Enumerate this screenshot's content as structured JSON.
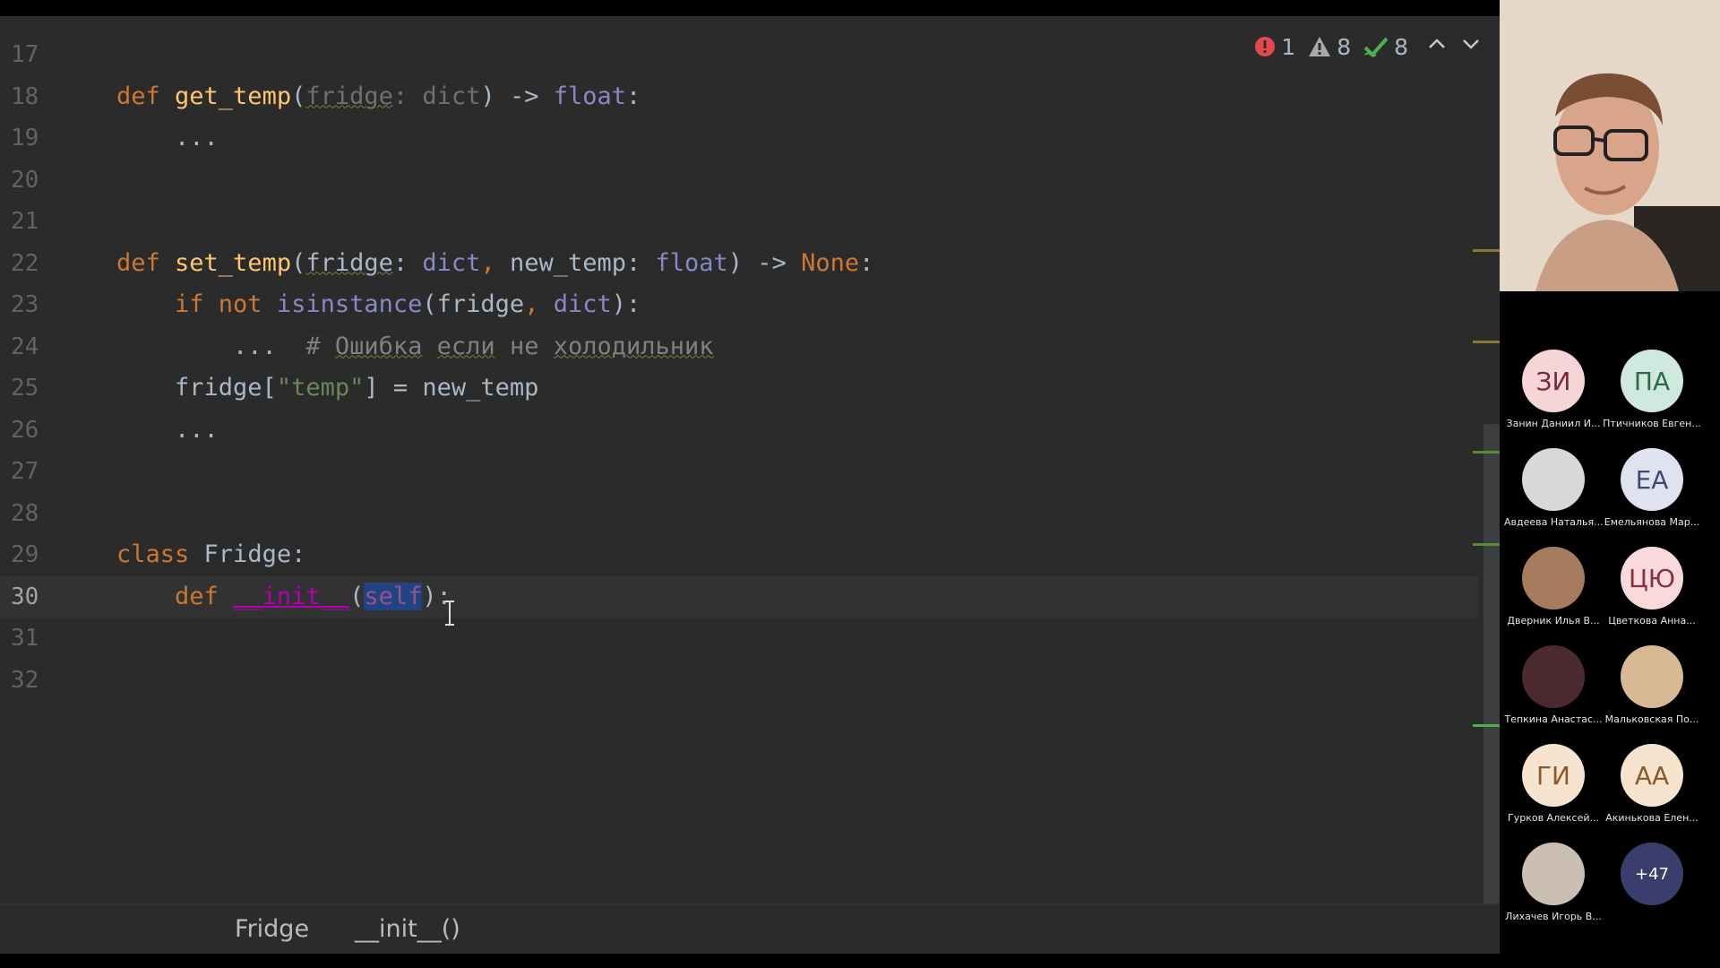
{
  "editor": {
    "lines": [
      {
        "num": "17",
        "tokens": []
      },
      {
        "num": "18",
        "tokens": [
          {
            "c": "kw",
            "t": "def "
          },
          {
            "c": "fn",
            "t": "get_temp"
          },
          {
            "c": "nu",
            "t": "("
          },
          {
            "c": "dim wv",
            "t": "fridge"
          },
          {
            "c": "dim",
            "t": ": "
          },
          {
            "c": "dim",
            "t": "dict"
          },
          {
            "c": "nu",
            "t": ") -> "
          },
          {
            "c": "bt",
            "t": "float"
          },
          {
            "c": "nu",
            "t": ":"
          }
        ]
      },
      {
        "num": "19",
        "tokens": [
          {
            "c": "nu",
            "t": "    ..."
          }
        ]
      },
      {
        "num": "20",
        "tokens": []
      },
      {
        "num": "21",
        "tokens": []
      },
      {
        "num": "22",
        "tokens": [
          {
            "c": "kw",
            "t": "def "
          },
          {
            "c": "fn",
            "t": "set_temp"
          },
          {
            "c": "nu",
            "t": "("
          },
          {
            "c": "nu wv",
            "t": "fridge"
          },
          {
            "c": "nu",
            "t": ": "
          },
          {
            "c": "bt",
            "t": "dict"
          },
          {
            "c": "kw",
            "t": ", "
          },
          {
            "c": "nu",
            "t": "new_temp: "
          },
          {
            "c": "bt",
            "t": "float"
          },
          {
            "c": "nu",
            "t": ") -> "
          },
          {
            "c": "kw",
            "t": "None"
          },
          {
            "c": "nu",
            "t": ":"
          }
        ]
      },
      {
        "num": "23",
        "tokens": [
          {
            "c": "nu",
            "t": "    "
          },
          {
            "c": "kw",
            "t": "if not "
          },
          {
            "c": "bt",
            "t": "isinstance"
          },
          {
            "c": "nu",
            "t": "(fridge"
          },
          {
            "c": "kw",
            "t": ", "
          },
          {
            "c": "bt",
            "t": "dict"
          },
          {
            "c": "nu",
            "t": "):"
          }
        ]
      },
      {
        "num": "24",
        "tokens": [
          {
            "c": "nu",
            "t": "        ...  "
          },
          {
            "c": "cm",
            "t": "# "
          },
          {
            "c": "cm wv",
            "t": "Ошибка"
          },
          {
            "c": "cm",
            "t": " "
          },
          {
            "c": "cm wv",
            "t": "если"
          },
          {
            "c": "cm",
            "t": " не "
          },
          {
            "c": "cm wv",
            "t": "холодильник"
          }
        ]
      },
      {
        "num": "25",
        "tokens": [
          {
            "c": "nu",
            "t": "    fridge["
          },
          {
            "c": "st",
            "t": "\"temp\""
          },
          {
            "c": "nu",
            "t": "] = new_temp"
          }
        ]
      },
      {
        "num": "26",
        "tokens": [
          {
            "c": "nu",
            "t": "    ..."
          }
        ]
      },
      {
        "num": "27",
        "tokens": []
      },
      {
        "num": "28",
        "tokens": []
      },
      {
        "num": "29",
        "tokens": [
          {
            "c": "kw",
            "t": "class "
          },
          {
            "c": "nu",
            "t": "Fridge:"
          }
        ]
      },
      {
        "num": "30",
        "current": true,
        "tokens": [
          {
            "c": "nu",
            "t": "    "
          },
          {
            "c": "kw",
            "t": "def "
          },
          {
            "c": "dn",
            "t": "__init__"
          },
          {
            "c": "nu",
            "t": "("
          },
          {
            "c": "sf",
            "t": "self"
          },
          {
            "c": "nu",
            "t": "):"
          }
        ]
      },
      {
        "num": "31",
        "tokens": []
      },
      {
        "num": "32",
        "tokens": []
      }
    ],
    "inspections": {
      "errors": "1",
      "warnings": "8",
      "typos": "8"
    },
    "breadcrumbs": [
      "Fridge",
      "__init__()"
    ]
  },
  "participants": [
    {
      "initials": "ЗИ",
      "name": "Занин Даниил И...",
      "color": "#f6d5d8",
      "text_color": "#7a2a32"
    },
    {
      "initials": "ПА",
      "name": "Птичников Евген...",
      "color": "#cfe9de",
      "text_color": "#2b6a4d"
    },
    {
      "initials": "",
      "name": "Авдеева Наталья...",
      "color": "#d8d8d8",
      "text_color": "#333"
    },
    {
      "initials": "ЕА",
      "name": "Емельянова Мар...",
      "color": "#e0e3ef",
      "text_color": "#3e4a75"
    },
    {
      "initials": "",
      "name": "Дверник Илья В...",
      "color": "#a57c5d",
      "text_color": "#333"
    },
    {
      "initials": "ЦЮ",
      "name": "Цветкова Анна...",
      "color": "#f9d9dc",
      "text_color": "#8a3039"
    },
    {
      "initials": "",
      "name": "Тепкина Анастас...",
      "color": "#4a2a30",
      "text_color": "#333"
    },
    {
      "initials": "",
      "name": "Мальковская По...",
      "color": "#d9b894",
      "text_color": "#333"
    },
    {
      "initials": "ГИ",
      "name": "Гурков Алексей...",
      "color": "#f6e4cf",
      "text_color": "#8a5a2b"
    },
    {
      "initials": "АА",
      "name": "Акинькова Елен...",
      "color": "#f6e4cf",
      "text_color": "#8a5a2b"
    },
    {
      "initials": "",
      "name": "Лихачев Игорь В...",
      "color": "#cbbfb3",
      "text_color": "#333"
    },
    {
      "initials": "+47",
      "name": "",
      "color": "#3a3e6c",
      "text_color": "#ffffff"
    }
  ]
}
